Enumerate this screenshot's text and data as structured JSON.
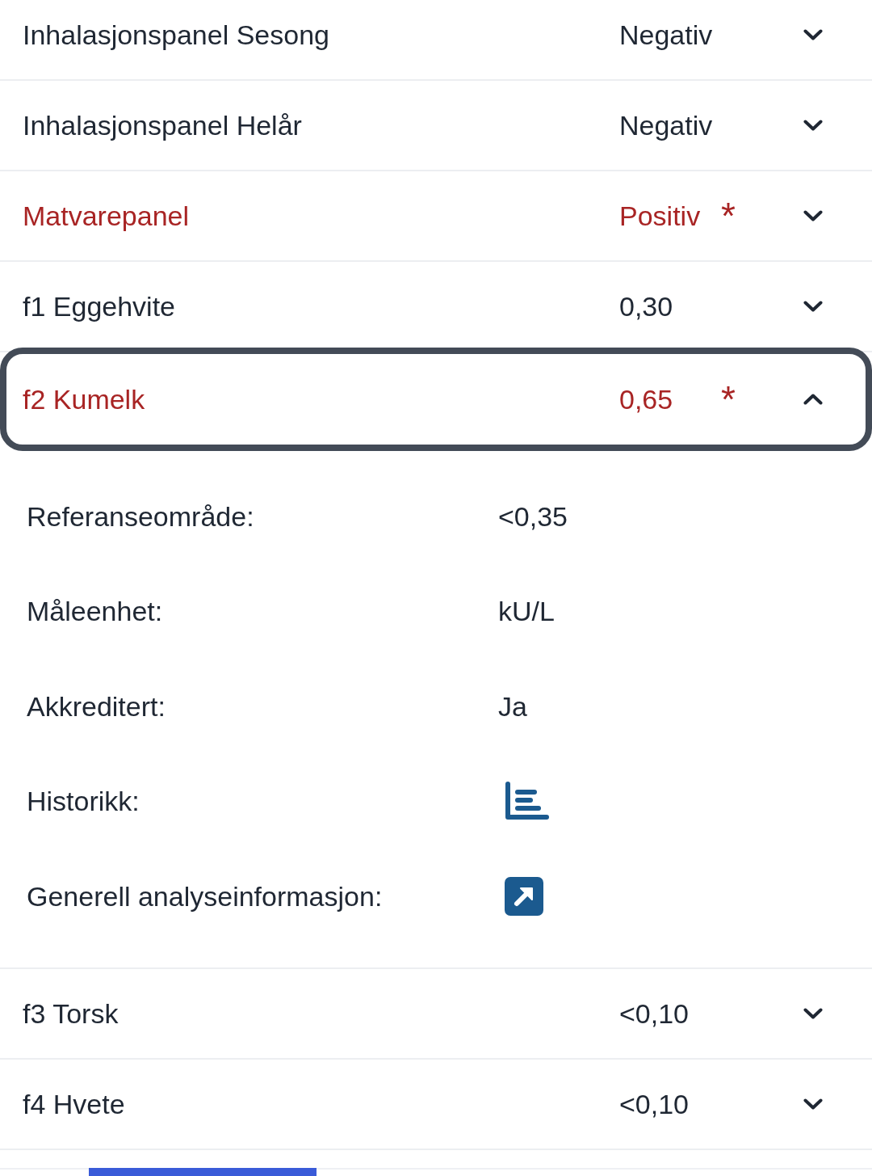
{
  "results": [
    {
      "name": "Inhalasjonspanel Sesong",
      "result": "Negativ",
      "abnormal": false,
      "focused": false,
      "expanded": false
    },
    {
      "name": "Inhalasjonspanel Helår",
      "result": "Negativ",
      "abnormal": false,
      "focused": false,
      "expanded": false
    },
    {
      "name": "Matvarepanel",
      "result": "Positiv",
      "marker": "*",
      "abnormal": true,
      "focused": false,
      "expanded": false
    },
    {
      "name": "f1 Eggehvite",
      "result": "0,30",
      "abnormal": false,
      "focused": false,
      "expanded": false
    },
    {
      "name": "f2 Kumelk",
      "result": "0,65",
      "marker": "*",
      "abnormal": true,
      "focused": true,
      "expanded": true,
      "details": [
        {
          "kind": "text",
          "label": "Referanseområde:",
          "value": "<0,35"
        },
        {
          "kind": "text",
          "label": "Måleenhet:",
          "value": "kU/L"
        },
        {
          "kind": "text",
          "label": "Akkreditert:",
          "value": "Ja"
        },
        {
          "kind": "chart",
          "label": "Historikk:"
        },
        {
          "kind": "link",
          "label": "Generell analyseinformasjon:"
        }
      ]
    },
    {
      "name": "f3 Torsk",
      "result": "<0,10",
      "abnormal": false,
      "focused": false,
      "expanded": false
    },
    {
      "name": "f4 Hvete",
      "result": "<0,10",
      "abnormal": false,
      "focused": false,
      "expanded": false
    }
  ]
}
